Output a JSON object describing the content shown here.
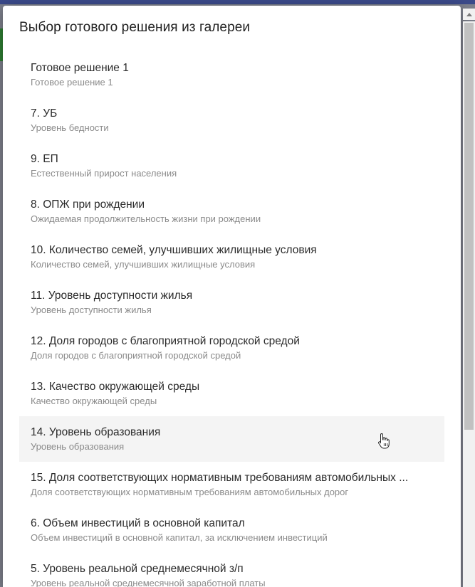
{
  "dialog": {
    "title": "Выбор готового решения из галереи",
    "items": [
      {
        "title": "Готовое решение 1",
        "subtitle": "Готовое решение 1"
      },
      {
        "title": "7. УБ",
        "subtitle": "Уровень бедности"
      },
      {
        "title": "9. ЕП",
        "subtitle": "Естественный прирост населения"
      },
      {
        "title": "8. ОПЖ при рождении",
        "subtitle": "Ожидаемая продолжительность жизни при рождении"
      },
      {
        "title": "10. Количество семей, улучшивших жилищные условия",
        "subtitle": "Количество семей, улучшивших жилищные условия"
      },
      {
        "title": "11. Уровень доступности жилья",
        "subtitle": "Уровень доступности жилья"
      },
      {
        "title": "12. Доля городов с благоприятной городской средой",
        "subtitle": "Доля городов с благоприятной городской средой"
      },
      {
        "title": "13. Качество окружающей среды",
        "subtitle": "Качество окружающей среды"
      },
      {
        "title": "14. Уровень образования",
        "subtitle": "Уровень образования"
      },
      {
        "title": "15. Доля соответствующих нормативным требованиям автомобильных ...",
        "subtitle": "Доля соответствующих нормативным требованиям автомобильных дорог"
      },
      {
        "title": "6. Объем инвестиций в основной капитал",
        "subtitle": "Объем инвестиций в основной капитал, за исключением инвестиций"
      },
      {
        "title": "5. Уровень реальной среднемесячной з/п",
        "subtitle": "Уровень реальной среднемесячной заработной платы"
      }
    ],
    "hovered_index": 8
  },
  "icons": {
    "scroll_up": "chevron-up-icon",
    "cursor": "hand-pointer-icon"
  },
  "colors": {
    "backdrop": "#7d808c",
    "hover": "#f4f4f4"
  }
}
